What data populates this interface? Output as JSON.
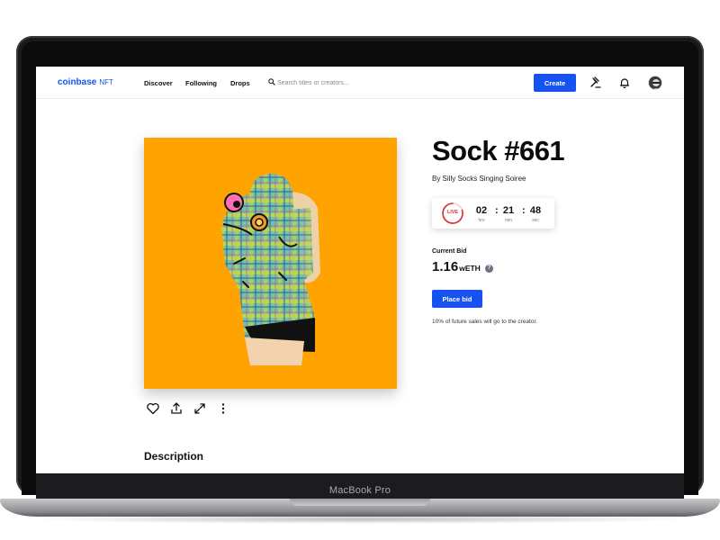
{
  "device": {
    "label": "MacBook Pro"
  },
  "nav": {
    "brand": "coinbase",
    "brand_sub": "NFT",
    "links": [
      "Discover",
      "Following",
      "Drops"
    ],
    "search_placeholder": "Search titles or creators...",
    "create_label": "Create",
    "icons": [
      "bid-hammer-icon",
      "bell-icon"
    ]
  },
  "nft": {
    "title": "Sock #661",
    "creator": "By Silly Socks Singing Soiree",
    "timer": {
      "live_label": "LIVE",
      "hours": "02",
      "hours_unit": "hrs",
      "minutes": "21",
      "minutes_unit": "min",
      "seconds": "48",
      "seconds_unit": "sec"
    },
    "current_bid_label": "Current Bid",
    "current_bid_amount": "1.16",
    "current_bid_currency": "wETH",
    "place_bid_label": "Place bid",
    "royalty_note": "10% of future sales will go to the creator.",
    "actions": [
      "heart-icon",
      "share-icon",
      "expand-icon",
      "more-icon"
    ]
  },
  "description_heading": "Description",
  "colors": {
    "brand_blue": "#1652f0",
    "artwork_bg": "#ffa301",
    "live_red": "#d63035"
  }
}
